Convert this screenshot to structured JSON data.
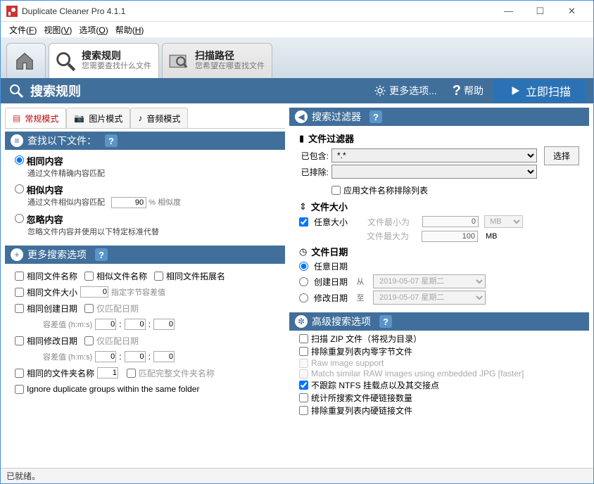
{
  "window": {
    "title": "Duplicate Cleaner Pro 4.1.1"
  },
  "menu": {
    "file": "文件(F)",
    "view": "视图(V)",
    "options": "选项(O)",
    "help": "帮助(H)"
  },
  "topTabs": {
    "search": {
      "title": "搜索规则",
      "sub": "您需要查找什么文件"
    },
    "scanpath": {
      "title": "扫描路径",
      "sub": "您希望在哪查找文件"
    }
  },
  "pageHeader": {
    "title": "搜索规则",
    "more": "更多选项...",
    "help": "帮助",
    "scan": "立即扫描"
  },
  "modes": {
    "normal": "常规模式",
    "image": "图片模式",
    "audio": "音频模式"
  },
  "findSection": {
    "header": "查找以下文件：",
    "sameContent": {
      "label": "相同内容",
      "desc": "通过文件精确内容匹配"
    },
    "similarContent": {
      "label": "相似内容",
      "desc": "通过文件相似内容匹配",
      "value": "90",
      "unit": "% 相似度"
    },
    "ignoreContent": {
      "label": "忽略内容",
      "desc": "忽略文件内容并使用以下特定标准代替"
    }
  },
  "moreSection": {
    "header": "更多搜索选项",
    "sameName": "相同文件名称",
    "similarName": "相似文件名称",
    "sameExt": "相同文件拓展名",
    "sameSize": "相同文件大小",
    "sizeVal": "0",
    "sizePh": "指定字节容差值",
    "sameCreated": "相同创建日期",
    "onlyDate1": "仅匹配日期",
    "tol": "容差值 (h:m:s)",
    "t0": "0",
    "sameModified": "相同修改日期",
    "onlyDate2": "仅匹配日期",
    "sameFolder": "相同的文件夹名称",
    "folderVal": "1",
    "matchFullFolder": "匹配完整文件夹名称",
    "ignoreGroups": "Ignore duplicate groups within the same folder"
  },
  "filterSection": {
    "header": "搜索过滤器",
    "fileFilter": "文件过滤器",
    "include": "已包含:",
    "includeVal": "*.*",
    "exclude": "已排除:",
    "excludeVal": "",
    "pick": "选择",
    "applyExclude": "应用文件名称排除列表",
    "sizeHdr": "文件大小",
    "anySize": "任意大小",
    "minLbl": "文件最小为",
    "maxLbl": "文件最大为",
    "minVal": "0",
    "maxVal": "100",
    "unit": "MB",
    "dateHdr": "文件日期",
    "anyDate": "任意日期",
    "created": "创建日期",
    "modified": "修改日期",
    "from": "从",
    "to": "至",
    "dateVal": "2019-05-07 星期二"
  },
  "advSection": {
    "header": "高级搜索选项",
    "zip": "扫描 ZIP 文件（将视为目录）",
    "zeroByte": "排除重复列表内零字节文件",
    "raw": "Raw image support",
    "rawJpg": "Match similar RAW images using embedded JPG [faster]",
    "ntfs": "不跟踪 NTFS 挂载点以及其交接点",
    "hardLinkCount": "统计所搜索文件硬链接数量",
    "hardLinkExclude": "排除重复列表内硬链接文件"
  },
  "status": "已就绪。"
}
